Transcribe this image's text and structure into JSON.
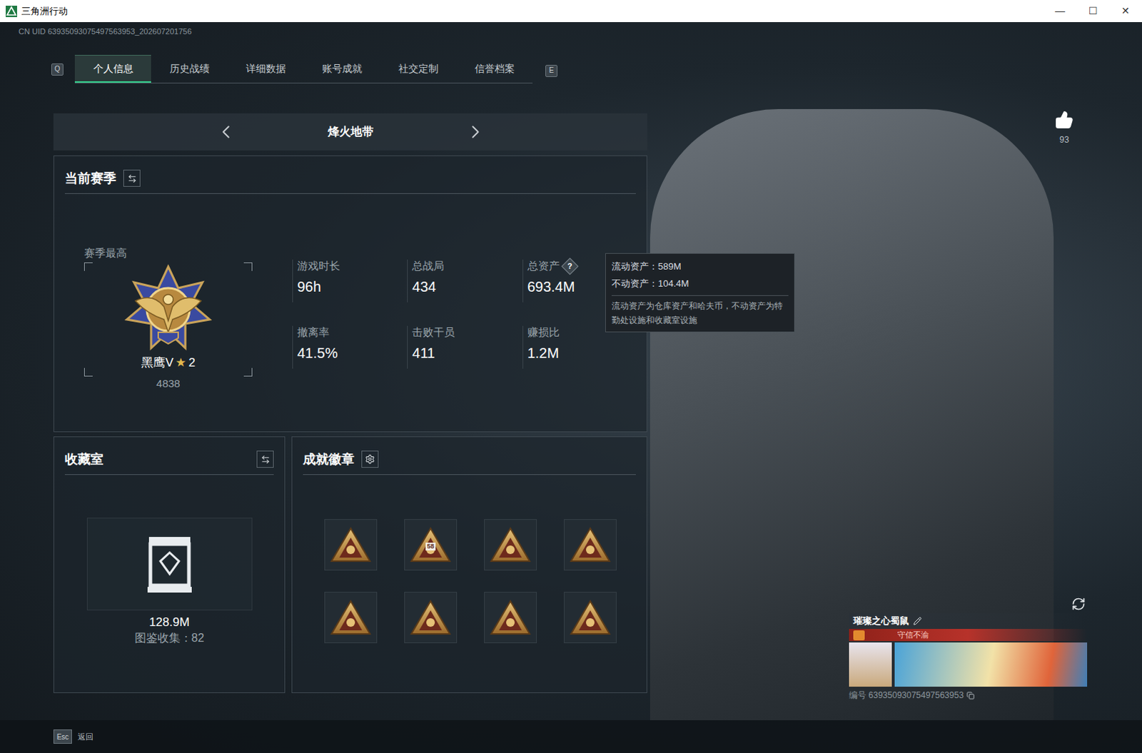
{
  "window": {
    "title": "三角洲行动",
    "controls": [
      "—",
      "☐",
      "✕"
    ]
  },
  "uid": "CN UID 63935093075497563953_202607201756",
  "tabs": {
    "prev_key": "Q",
    "next_key": "E",
    "items": [
      {
        "label": "个人信息",
        "selected": true
      },
      {
        "label": "历史战绩",
        "selected": false
      },
      {
        "label": "详细数据",
        "selected": false
      },
      {
        "label": "账号成就",
        "selected": false
      },
      {
        "label": "社交定制",
        "selected": false
      },
      {
        "label": "信誉档案",
        "selected": false
      }
    ]
  },
  "mode": {
    "label": "烽火地带"
  },
  "season": {
    "title": "当前赛季",
    "best_label": "赛季最高",
    "rank": "黑鹰V",
    "rank_star": "★",
    "rank_level": "2",
    "score": "4838",
    "stats": [
      {
        "label": "游戏时长",
        "value": "96h"
      },
      {
        "label": "总战局",
        "value": "434"
      },
      {
        "label": "总资产",
        "value": "693.4M",
        "hint": "?"
      },
      {
        "label": "撤离率",
        "value": "41.5%"
      },
      {
        "label": "击败干员",
        "value": "411"
      },
      {
        "label": "赚损比",
        "value": "1.2M"
      }
    ]
  },
  "tooltip": {
    "lines": [
      "流动资产：589M",
      "不动资产：104.4M"
    ],
    "note": "流动资产为仓库资产和哈夫币，不动资产为特勤处设施和收藏室设施"
  },
  "collection": {
    "title": "收藏室",
    "value": "128.9M",
    "catalog": "图鉴收集：82"
  },
  "achievements": {
    "title": "成就徽章",
    "badges": [
      {
        "kind": "plain"
      },
      {
        "kind": "number",
        "text": "58"
      },
      {
        "kind": "plain"
      },
      {
        "kind": "plain"
      },
      {
        "kind": "plain"
      },
      {
        "kind": "plain"
      },
      {
        "kind": "plain"
      },
      {
        "kind": "plain"
      }
    ]
  },
  "likes": "93",
  "profile": {
    "name": "璀璨之心蜀鼠",
    "title": "守信不渝",
    "id": "编号 63935093075497563953"
  },
  "footer": {
    "key": "Esc",
    "label": "返回"
  }
}
